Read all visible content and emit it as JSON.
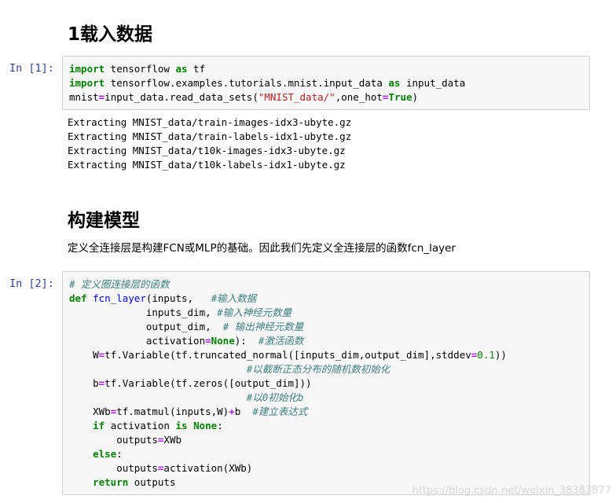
{
  "heading1": "1载入数据",
  "cell1": {
    "prompt": "In  [1]:",
    "lines": [
      [
        {
          "t": "import",
          "c": "kw"
        },
        {
          "t": " tensorflow ",
          "c": ""
        },
        {
          "t": "as",
          "c": "kw"
        },
        {
          "t": " tf",
          "c": ""
        }
      ],
      [
        {
          "t": "import",
          "c": "kw"
        },
        {
          "t": " tensorflow.examples.tutorials.mnist.input_data ",
          "c": ""
        },
        {
          "t": "as",
          "c": "kw"
        },
        {
          "t": " input_data",
          "c": ""
        }
      ],
      [
        {
          "t": "mnist",
          "c": ""
        },
        {
          "t": "=",
          "c": "op"
        },
        {
          "t": "input_data.read_data_sets(",
          "c": ""
        },
        {
          "t": "\"MNIST_data/\"",
          "c": "str"
        },
        {
          "t": ",one_hot",
          "c": ""
        },
        {
          "t": "=",
          "c": "op"
        },
        {
          "t": "True",
          "c": "kw"
        },
        {
          "t": ")",
          "c": ""
        }
      ]
    ]
  },
  "output1": [
    "Extracting MNIST_data/train-images-idx3-ubyte.gz",
    "Extracting MNIST_data/train-labels-idx1-ubyte.gz",
    "Extracting MNIST_data/t10k-images-idx3-ubyte.gz",
    "Extracting MNIST_data/t10k-labels-idx1-ubyte.gz"
  ],
  "heading2": "构建模型",
  "paragraph": "定义全连接层是构建FCN或MLP的基础。因此我们先定义全连接层的函数fcn_layer",
  "cell2": {
    "prompt": "In  [2]:",
    "lines": [
      [
        {
          "t": "# 定义圈连接层的函数",
          "c": "cmt"
        }
      ],
      [
        {
          "t": "def",
          "c": "kw"
        },
        {
          "t": " ",
          "c": ""
        },
        {
          "t": "fcn_layer",
          "c": "fn"
        },
        {
          "t": "(inputs,   ",
          "c": ""
        },
        {
          "t": "#输入数据",
          "c": "cmt"
        }
      ],
      [
        {
          "t": "             inputs_dim, ",
          "c": ""
        },
        {
          "t": "#输入神经元数量",
          "c": "cmt"
        }
      ],
      [
        {
          "t": "             output_dim,  ",
          "c": ""
        },
        {
          "t": "# 输出神经元数量",
          "c": "cmt"
        }
      ],
      [
        {
          "t": "             activation",
          "c": ""
        },
        {
          "t": "=",
          "c": "op"
        },
        {
          "t": "None",
          "c": "kw"
        },
        {
          "t": "):  ",
          "c": ""
        },
        {
          "t": "#激活函数",
          "c": "cmt"
        }
      ],
      [
        {
          "t": "    W",
          "c": ""
        },
        {
          "t": "=",
          "c": "op"
        },
        {
          "t": "tf.Variable(tf.truncated_normal([inputs_dim,output_dim],stddev",
          "c": ""
        },
        {
          "t": "=",
          "c": "op"
        },
        {
          "t": "0.1",
          "c": "num"
        },
        {
          "t": "))",
          "c": ""
        }
      ],
      [
        {
          "t": "                              ",
          "c": ""
        },
        {
          "t": "#以截断正态分布的随机数初始化",
          "c": "cmt"
        }
      ],
      [
        {
          "t": "    b",
          "c": ""
        },
        {
          "t": "=",
          "c": "op"
        },
        {
          "t": "tf.Variable(tf.zeros([output_dim]))",
          "c": ""
        }
      ],
      [
        {
          "t": "                              ",
          "c": ""
        },
        {
          "t": "#以0初始化b",
          "c": "cmt"
        }
      ],
      [
        {
          "t": "    XWb",
          "c": ""
        },
        {
          "t": "=",
          "c": "op"
        },
        {
          "t": "tf.matmul(inputs,W)",
          "c": ""
        },
        {
          "t": "+",
          "c": "op"
        },
        {
          "t": "b  ",
          "c": ""
        },
        {
          "t": "#建立表达式",
          "c": "cmt"
        }
      ],
      [
        {
          "t": "    ",
          "c": ""
        },
        {
          "t": "if",
          "c": "kw"
        },
        {
          "t": " activation ",
          "c": ""
        },
        {
          "t": "is",
          "c": "kw"
        },
        {
          "t": " ",
          "c": ""
        },
        {
          "t": "None",
          "c": "kw"
        },
        {
          "t": ":",
          "c": ""
        }
      ],
      [
        {
          "t": "        outputs",
          "c": ""
        },
        {
          "t": "=",
          "c": "op"
        },
        {
          "t": "XWb",
          "c": ""
        }
      ],
      [
        {
          "t": "    ",
          "c": ""
        },
        {
          "t": "else",
          "c": "kw"
        },
        {
          "t": ":",
          "c": ""
        }
      ],
      [
        {
          "t": "        outputs",
          "c": ""
        },
        {
          "t": "=",
          "c": "op"
        },
        {
          "t": "activation(XWb)",
          "c": ""
        }
      ],
      [
        {
          "t": "    ",
          "c": ""
        },
        {
          "t": "return",
          "c": "kw"
        },
        {
          "t": " outputs",
          "c": ""
        }
      ]
    ]
  },
  "watermark": "https://blog.csdn.net/weixin_38383877",
  "colors": {
    "keyword": "#008000",
    "string": "#ba2121",
    "comment": "#408080",
    "function": "#0000ff",
    "operator": "#aa22ff",
    "prompt": "#303f9f",
    "cell_bg": "#f7f7f7"
  }
}
